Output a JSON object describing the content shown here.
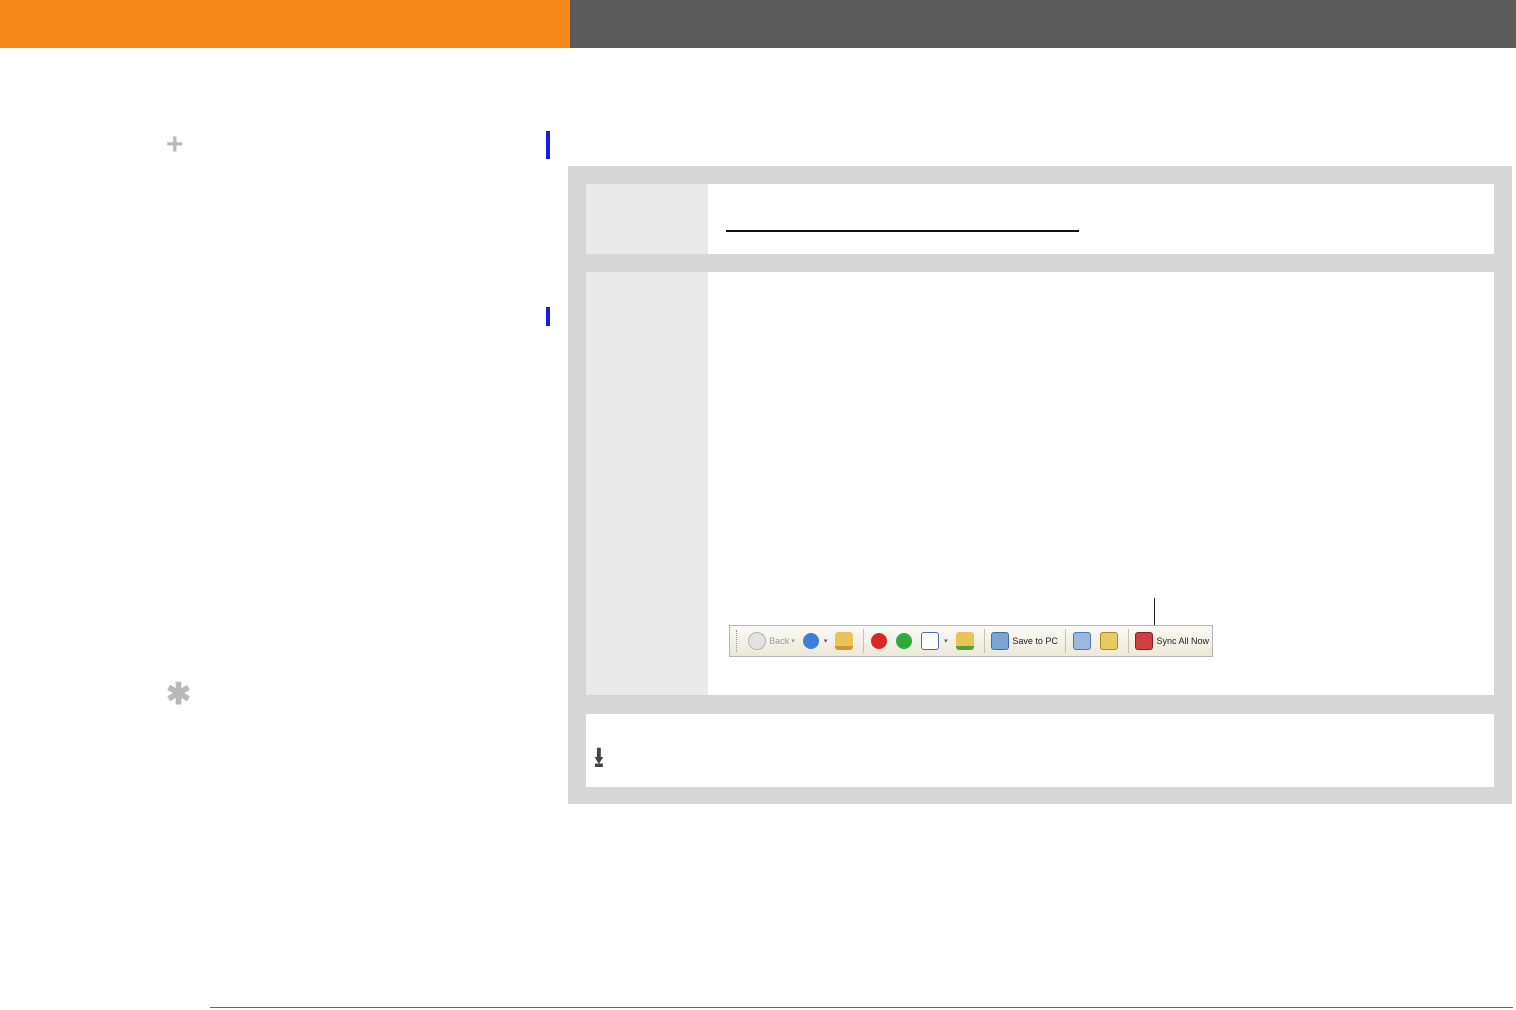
{
  "icons": {
    "plus": "+",
    "asterisk": "✱",
    "download": "⭳"
  },
  "toolbar": {
    "back_label": "Back",
    "save_to_pc_label": "Save to PC",
    "sync_all_now_label": "Sync All Now",
    "dropdown_glyph": "▾"
  },
  "colors": {
    "header_orange": "#f7891b",
    "header_gray": "#5a5a5a",
    "change_bar_blue": "#1a1ae6",
    "panel_gray": "#d6d6d6"
  }
}
